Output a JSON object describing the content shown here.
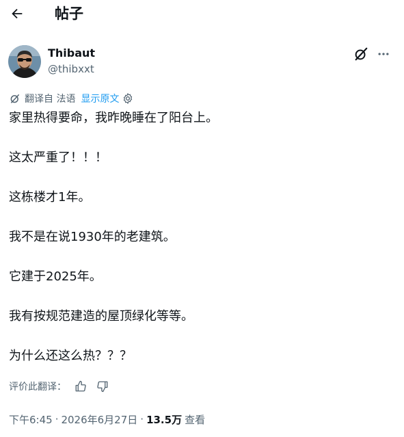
{
  "header": {
    "title": "帖子",
    "back_icon": "arrow-left-icon"
  },
  "author": {
    "display_name": "Thibaut",
    "handle": "@thibxxt",
    "avatar_icon": "avatar-photo"
  },
  "actions": {
    "grok_icon": "grok-icon",
    "more_icon": "more-horizontal-icon"
  },
  "translation": {
    "label": "翻译自 法语",
    "show_original": "显示原文"
  },
  "post": {
    "lines": [
      "家里热得要命，我昨晚睡在了阳台上。",
      "这太严重了！！！",
      "这栋楼才1年。",
      "我不是在说1930年的老建筑。",
      "它建于2025年。",
      "我有按规范建造的屋顶绿化等等。",
      "为什么还这么热？？？"
    ]
  },
  "rate": {
    "label": "评价此翻译："
  },
  "meta": {
    "time": "下午6:45",
    "separator": "·",
    "date": "2026年6月27日",
    "views_count": "13.5万",
    "views_label": "查看"
  },
  "colors": {
    "text": "#0f1419",
    "secondary": "#536471",
    "link": "#1d9bf0"
  }
}
